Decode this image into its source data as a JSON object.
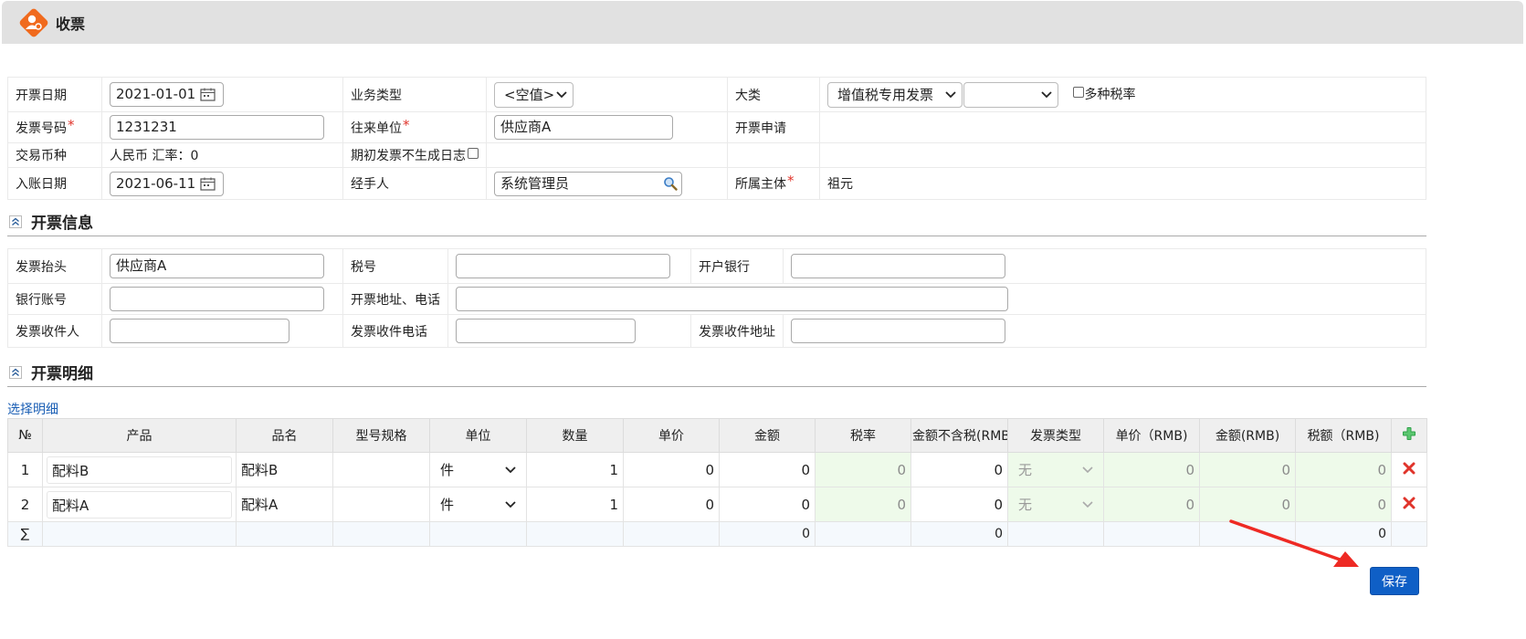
{
  "window": {
    "title": "收票"
  },
  "header": {
    "fields": {
      "invoice_date": {
        "label": "开票日期",
        "value": "2021-01-01"
      },
      "business_type": {
        "label": "业务类型",
        "value": "<空值>"
      },
      "category": {
        "label": "大类",
        "value": "增值税专用发票",
        "sub_value": ""
      },
      "multi_tax_rate": {
        "label": "多种税率",
        "checked": false
      },
      "invoice_number": {
        "label": "发票号码",
        "value": "1231231"
      },
      "counterparty": {
        "label": "往来单位",
        "value": "供应商A"
      },
      "invoice_request": {
        "label": "开票申请",
        "value": ""
      },
      "currency": {
        "label": "交易币种",
        "value": "人民币 汇率：0"
      },
      "no_initial_log": {
        "label": "期初发票不生成日志",
        "checked": false
      },
      "posting_date": {
        "label": "入账日期",
        "value": "2021-06-11"
      },
      "handler": {
        "label": "经手人",
        "value": "系统管理员"
      },
      "entity": {
        "label": "所属主体",
        "value": "祖元"
      }
    }
  },
  "billing_section": {
    "title": "开票信息",
    "fields": {
      "invoice_title": {
        "label": "发票抬头",
        "value": "供应商A"
      },
      "tax_number": {
        "label": "税号",
        "value": ""
      },
      "bank": {
        "label": "开户银行",
        "value": ""
      },
      "bank_account": {
        "label": "银行账号",
        "value": ""
      },
      "address_phone": {
        "label": "开票地址、电话",
        "value": ""
      },
      "recipient": {
        "label": "发票收件人",
        "value": ""
      },
      "recipient_phone": {
        "label": "发票收件电话",
        "value": ""
      },
      "recipient_address": {
        "label": "发票收件地址",
        "value": ""
      }
    }
  },
  "detail_section": {
    "title": "开票明细",
    "select_link": "选择明细",
    "columns": [
      "№",
      "产品",
      "品名",
      "型号规格",
      "单位",
      "数量",
      "单价",
      "金额",
      "税率",
      "金额不含税(RMB",
      "发票类型",
      "单价（RMB)",
      "金额(RMB)",
      "税额（RMB)"
    ],
    "rows": [
      {
        "no": "1",
        "product": "配料B",
        "name": "配料B",
        "spec": "",
        "unit": "件",
        "qty": "1",
        "price": "0",
        "amount": "0",
        "tax_rate": "0",
        "amount_excl_tax": "0",
        "invoice_type": "无",
        "price_rmb": "0",
        "amount_rmb": "0",
        "tax_rmb": "0"
      },
      {
        "no": "2",
        "product": "配料A",
        "name": "配料A",
        "spec": "",
        "unit": "件",
        "qty": "1",
        "price": "0",
        "amount": "0",
        "tax_rate": "0",
        "amount_excl_tax": "0",
        "invoice_type": "无",
        "price_rmb": "0",
        "amount_rmb": "0",
        "tax_rmb": "0"
      }
    ],
    "sum_row": {
      "symbol": "∑",
      "amount": "0",
      "amount_excl_tax": "0",
      "tax_rmb": "0"
    }
  },
  "actions": {
    "save_label": "保存"
  },
  "colors": {
    "accent": "#0f5fc6",
    "logo": "#f06a1d",
    "required": "#e0342b",
    "link": "#1b5fb5",
    "readonly_cell": "#eefaea",
    "delete": "#e0342b",
    "add": "#2fa24a"
  },
  "icons": [
    "user-logo-icon",
    "calendar-icon",
    "chevron-down-icon",
    "magnifier-icon",
    "collapse-icon",
    "add-row-icon",
    "delete-row-icon"
  ]
}
